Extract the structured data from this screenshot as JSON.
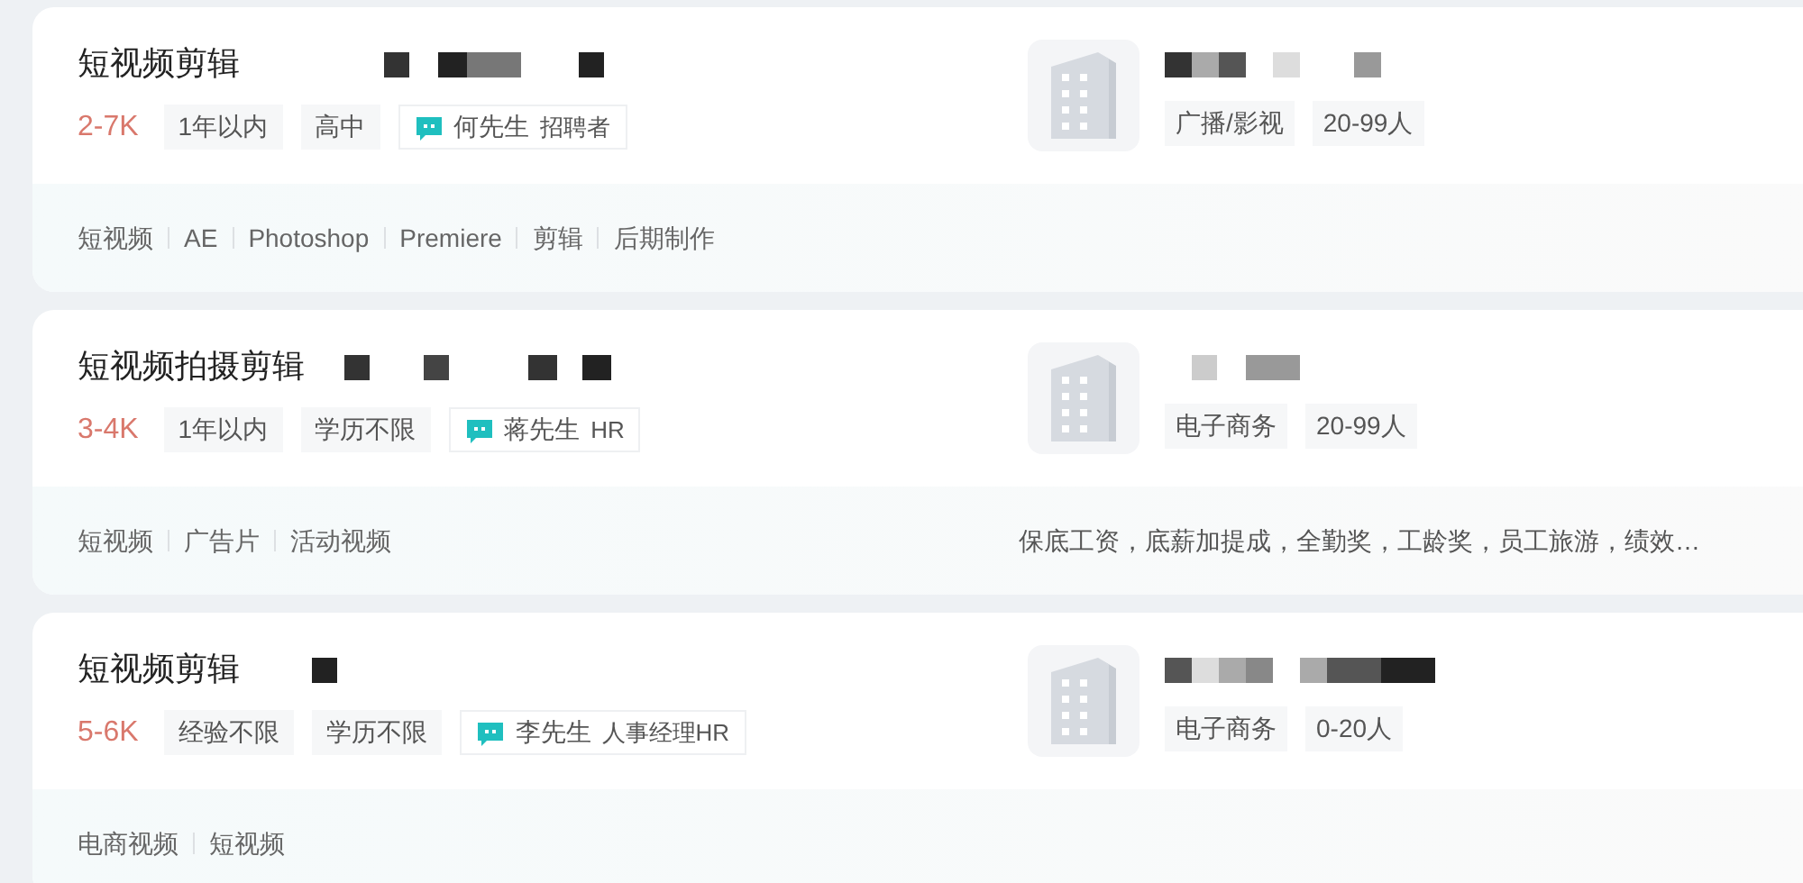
{
  "jobs": [
    {
      "title": "短视频剪辑",
      "salary": "2-7K",
      "requirements": [
        "1年以内",
        "高中"
      ],
      "recruiter": {
        "name": "何先生",
        "role": "招聘者"
      },
      "company": {
        "industry": "广播/影视",
        "size": "20-99人"
      },
      "skills": [
        "短视频",
        "AE",
        "Photoshop",
        "Premiere",
        "剪辑",
        "后期制作"
      ]
    },
    {
      "title": "短视频拍摄剪辑",
      "salary": "3-4K",
      "requirements": [
        "1年以内",
        "学历不限"
      ],
      "recruiter": {
        "name": "蒋先生",
        "role": "HR"
      },
      "company": {
        "industry": "电子商务",
        "size": "20-99人"
      },
      "skills": [
        "短视频",
        "广告片",
        "活动视频"
      ],
      "benefits": "保底工资，底薪加提成，全勤奖，工龄奖，员工旅游，绩效…"
    },
    {
      "title": "短视频剪辑",
      "salary": "5-6K",
      "requirements": [
        "经验不限",
        "学历不限"
      ],
      "recruiter": {
        "name": "李先生",
        "role": "人事经理HR"
      },
      "company": {
        "industry": "电子商务",
        "size": "0-20人"
      },
      "skills": [
        "电商视频",
        "短视频"
      ]
    }
  ]
}
